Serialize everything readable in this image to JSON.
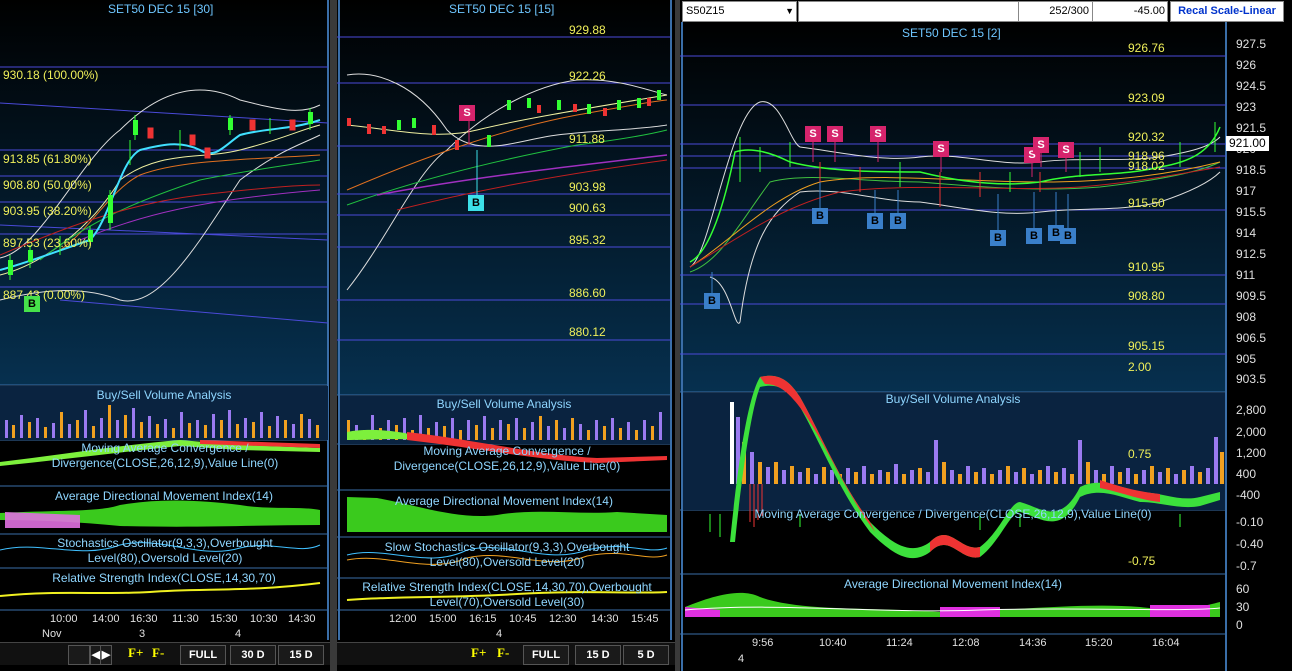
{
  "colors": {
    "price_line": "#5a5ad8",
    "level": "#f0f05a",
    "buy": "#46e24a",
    "sell": "#d6246c"
  },
  "panel1": {
    "title": "SET50 DEC 15  [30]",
    "fib_levels": [
      "930.18 (100.00%)",
      "913.85 (61.80%)",
      "908.80 (50.00%)",
      "903.95 (38.20%)",
      "897.53 (23.60%)",
      "887.43 (0.00%)"
    ],
    "buy_marker": "B",
    "indicators": [
      "Buy/Sell Volume Analysis",
      "Moving Average Convergence / Divergence(CLOSE,26,12,9),Value Line(0)",
      "Average Directional Movement Index(14)",
      "Stochastics Oscillator(9,3,3),Overbought Level(80),Oversold Level(20)",
      "Relative Strength Index(CLOSE,14,30,70)"
    ],
    "time_labels": [
      "10:00",
      "14:00",
      "16:30",
      "11:30",
      "15:30",
      "10:30",
      "14:30"
    ],
    "date_labels": [
      "Nov",
      "3",
      "4"
    ],
    "buttons": {
      "f_plus": "F+",
      "f_minus": "F-",
      "full": "FULL",
      "d30": "30 D",
      "d15": "15 D"
    }
  },
  "panel2": {
    "title": "SET50 DEC 15  [15]",
    "levels": [
      "929.88",
      "922.26",
      "911.88",
      "903.98",
      "900.63",
      "895.32",
      "886.60",
      "880.12"
    ],
    "markers": {
      "sell": "S",
      "buy": "B"
    },
    "indicators": [
      "Buy/Sell Volume Analysis",
      "Moving Average Convergence / Divergence(CLOSE,26,12,9),Value Line(0)",
      "Average Directional Movement Index(14)",
      "Slow Stochastics Oscillator(9,3,3),Overbought Level(80),Oversold Level(20)",
      "Relative Strength Index(CLOSE,14,30,70),Overbought Level(70),Oversold Level(30)"
    ],
    "time_labels": [
      "12:00",
      "15:00",
      "16:15",
      "10:45",
      "12:30",
      "14:30",
      "15:45"
    ],
    "date_labels": [
      "4"
    ],
    "buttons": {
      "f_plus": "F+",
      "f_minus": "F-",
      "full": "FULL",
      "d15": "15 D",
      "d5": "5 D"
    }
  },
  "panel3": {
    "symbol": "S50Z15",
    "counter": "252/300",
    "change": "-45.00",
    "recal_button": "Recal Scale-Linear",
    "title": "SET50 DEC 15  [2]",
    "levels": [
      "926.76",
      "923.09",
      "920.32",
      "918.96",
      "918.02",
      "915.50",
      "910.95",
      "908.80",
      "905.15",
      "2.00"
    ],
    "price_axis": [
      "927.5",
      "926",
      "924.5",
      "923",
      "921.5",
      "920",
      "918.5",
      "917",
      "915.5",
      "914",
      "912.5",
      "911",
      "909.5",
      "908",
      "906.5",
      "905",
      "903.5"
    ],
    "current_price": "921.00",
    "markers_sell": [
      "S",
      "S",
      "S",
      "S",
      "S",
      "S",
      "S"
    ],
    "markers_buy": [
      "B",
      "B",
      "B",
      "B",
      "B",
      "B",
      "B",
      "B"
    ],
    "volume_title": "Buy/Sell Volume Analysis",
    "volume_axis": [
      "2,800",
      "2,000",
      "1,200",
      "400",
      "-400"
    ],
    "volume_level": "0.75",
    "macd_title": "Moving Average Convergence / Divergence(CLOSE,26,12,9),Value Line(0)",
    "macd_axis": [
      "-0.10",
      "-0.40",
      "-0.7"
    ],
    "macd_level": "-0.75",
    "adx_title": "Average Directional Movement Index(14)",
    "adx_axis": [
      "60",
      "30",
      "0"
    ],
    "time_labels": [
      "9:56",
      "10:40",
      "11:24",
      "12:08",
      "14:36",
      "15:20",
      "16:04"
    ],
    "date_labels": [
      "4"
    ]
  }
}
